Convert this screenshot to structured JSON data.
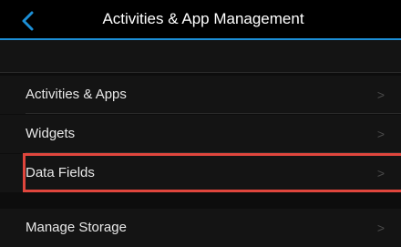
{
  "header": {
    "title": "Activities & App Management",
    "back_icon": "chevron-left-icon",
    "accent_color": "#1c8fd6"
  },
  "menu": {
    "items": [
      {
        "label": "Activities & Apps",
        "chevron": ">"
      },
      {
        "label": "Widgets",
        "chevron": ">"
      },
      {
        "label": "Data Fields",
        "chevron": ">"
      },
      {
        "label": "Manage Storage",
        "chevron": ">"
      }
    ]
  },
  "highlight": {
    "target": "Data Fields",
    "color": "#e0463d"
  }
}
